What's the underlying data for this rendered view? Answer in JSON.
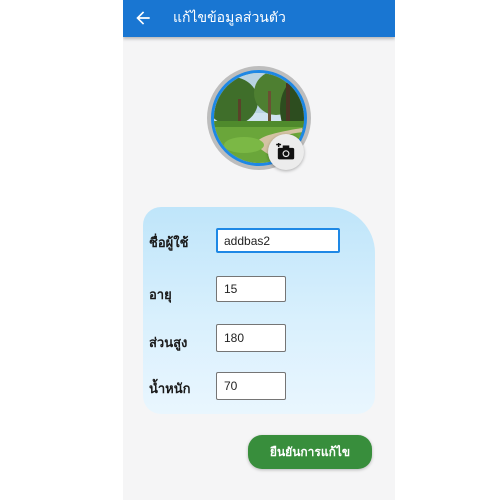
{
  "appbar": {
    "title": "แก้ไขข้อมูลส่วนตัว",
    "back_icon": "arrow-back-icon",
    "color": "#1976d2"
  },
  "profile": {
    "avatar_description": "park-path-photo",
    "ring_color": "#1e88e5",
    "camera_icon": "add-a-photo-icon"
  },
  "form": {
    "fields": [
      {
        "label": "ชื่อผู้ใช้",
        "value": "addbas2",
        "focused": true
      },
      {
        "label": "อายุ",
        "value": "15"
      },
      {
        "label": "ส่วนสูง",
        "value": "180"
      },
      {
        "label": "น้ำหนัก",
        "value": "70"
      }
    ]
  },
  "confirm_button": {
    "label": "ยืนยันการแก้ไข",
    "color": "#388e3c"
  }
}
